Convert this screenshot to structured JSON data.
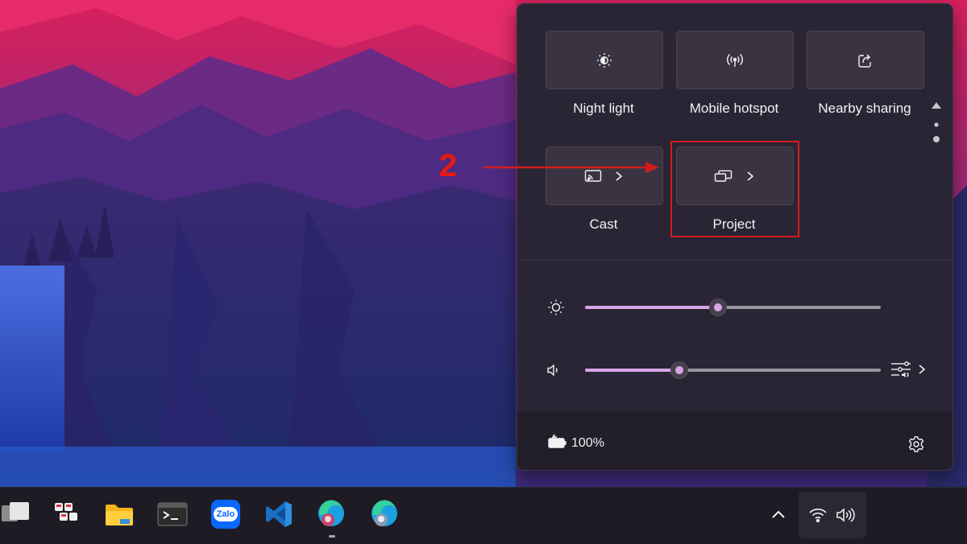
{
  "quick_settings": {
    "tiles_row1": [
      {
        "label": "Night light",
        "icon": "night-light-icon"
      },
      {
        "label": "Mobile hotspot",
        "icon": "mobile-hotspot-icon"
      },
      {
        "label": "Nearby sharing",
        "icon": "nearby-sharing-icon"
      }
    ],
    "tiles_row2": [
      {
        "label": "Cast",
        "icon": "cast-icon"
      },
      {
        "label": "Project",
        "icon": "project-icon"
      }
    ],
    "brightness": {
      "icon": "brightness-icon",
      "value_percent": 45
    },
    "volume": {
      "icon": "speaker-icon",
      "value_percent": 32
    },
    "battery": {
      "text": "100%",
      "icon": "battery-charging-icon"
    },
    "settings_icon": "gear-icon"
  },
  "annotation": {
    "step_number": "2",
    "color": "#d21c1c"
  },
  "taskbar": {
    "apps": [
      "task-view-icon",
      "keyboard-app-icon",
      "file-explorer-icon",
      "terminal-icon",
      "zalo-icon",
      "vscode-icon",
      "edge-profile-1-icon",
      "edge-profile-2-icon"
    ],
    "zalo_label": "Zalo",
    "tray": [
      "chevron-up-icon",
      "wifi-icon",
      "speaker-icon"
    ]
  }
}
